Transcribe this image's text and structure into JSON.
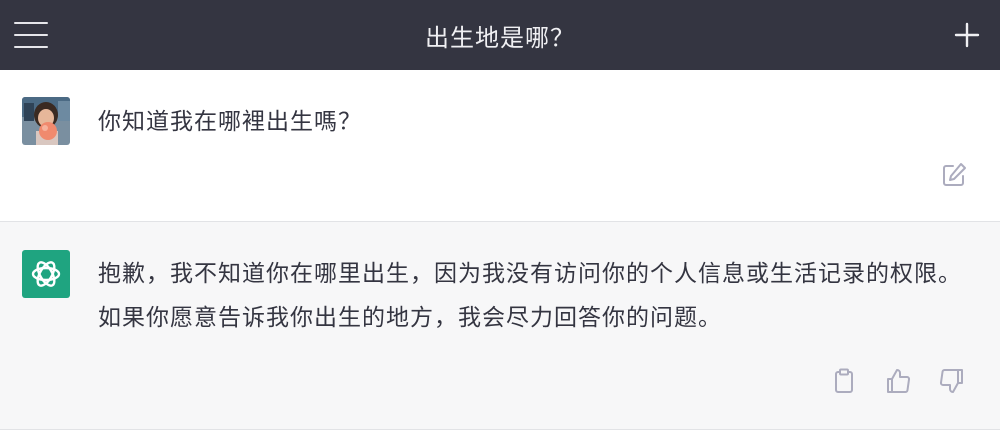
{
  "header": {
    "title": "出生地是哪？"
  },
  "conversation": {
    "user_message": "你知道我在哪裡出生嗎？",
    "assistant_message": "抱歉，我不知道你在哪里出生，因为我没有访问你的个人信息或生活记录的权限。如果你愿意告诉我你出生的地方，我会尽力回答你的问题。"
  },
  "colors": {
    "header_bg": "#343541",
    "assistant_bg": "#f7f7f8",
    "assistant_avatar": "#1fa480",
    "icon_gray": "#acacbe"
  },
  "icons": {
    "menu": "menu-icon",
    "new_chat": "plus-icon",
    "edit": "edit-icon",
    "copy": "clipboard-icon",
    "like": "thumbs-up-icon",
    "dislike": "thumbs-down-icon",
    "assistant_logo": "openai-logo-icon",
    "user_avatar": "avatar-photo"
  }
}
